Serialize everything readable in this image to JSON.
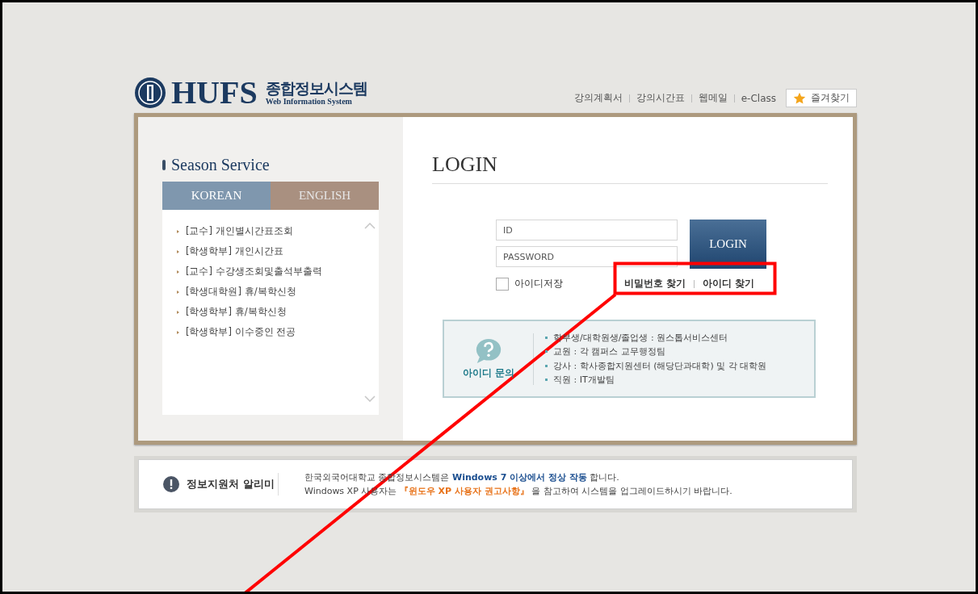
{
  "header": {
    "logo_text": "HUFS",
    "logo_korean": "종합정보시스템",
    "logo_subtitle": "Web Information System",
    "links": [
      "강의계획서",
      "강의시간표",
      "웹메일",
      "e-Class"
    ],
    "favorites_button": "즐겨찾기"
  },
  "season_service": {
    "title": "Season Service",
    "tabs": [
      {
        "label": "KOREAN",
        "selected": true
      },
      {
        "label": "ENGLISH",
        "selected": false
      }
    ],
    "items": [
      "[교수] 개인별시간표조회",
      "[학생학부] 개인시간표",
      "[교수] 수강생조회및출석부출력",
      "[학생대학원] 휴/복학신청",
      "[학생학부] 휴/복학신청",
      "[학생학부] 이수중인 전공"
    ]
  },
  "login": {
    "title": "LOGIN",
    "id_placeholder": "ID",
    "password_placeholder": "PASSWORD",
    "button": "LOGIN",
    "remember": {
      "label": "아이디저장",
      "checked": false
    },
    "links": [
      "비밀번호 찾기",
      "아이디 찾기"
    ]
  },
  "inquiry": {
    "title": "아이디 문의",
    "items": [
      "학부생/대학원생/졸업생 : 원스톱서비스센터",
      "교원 : 각 캠퍼스 교무행정팀",
      "강사 : 학사종합지원센터 (해당단과대학) 및 각 대학원",
      "직원 : IT개발팀"
    ]
  },
  "notice": {
    "title": "정보지원처 알리미",
    "lines": [
      "한국외국어대학교 종합정보시스템은 **Windows 7 이상에서 정상 작동** 합니다.",
      "Windows XP 사용자는 **『윈도우 XP 사용자 권고사항』** 을 참고하여 시스템을 업그레이드하시기 바랍니다."
    ]
  }
}
